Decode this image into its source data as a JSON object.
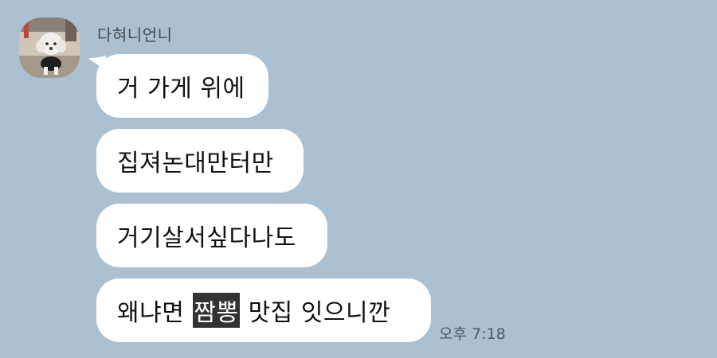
{
  "chat": {
    "sender_name": "다혀니언니",
    "avatar_icon": "dog-photo-avatar",
    "background_color": "#abc1d1",
    "bubble_color": "#ffffff",
    "messages": [
      {
        "text_before": "거 가게 위에",
        "highlight": "",
        "text_after": ""
      },
      {
        "text_before": "집져논대만터만",
        "highlight": "",
        "text_after": ""
      },
      {
        "text_before": "거기살서싶다나도",
        "highlight": "",
        "text_after": ""
      },
      {
        "text_before": "왜냐면 ",
        "highlight": "짬뽕",
        "text_after": " 맛집 잇으니깐"
      }
    ],
    "timestamp": "오후 7:18"
  }
}
